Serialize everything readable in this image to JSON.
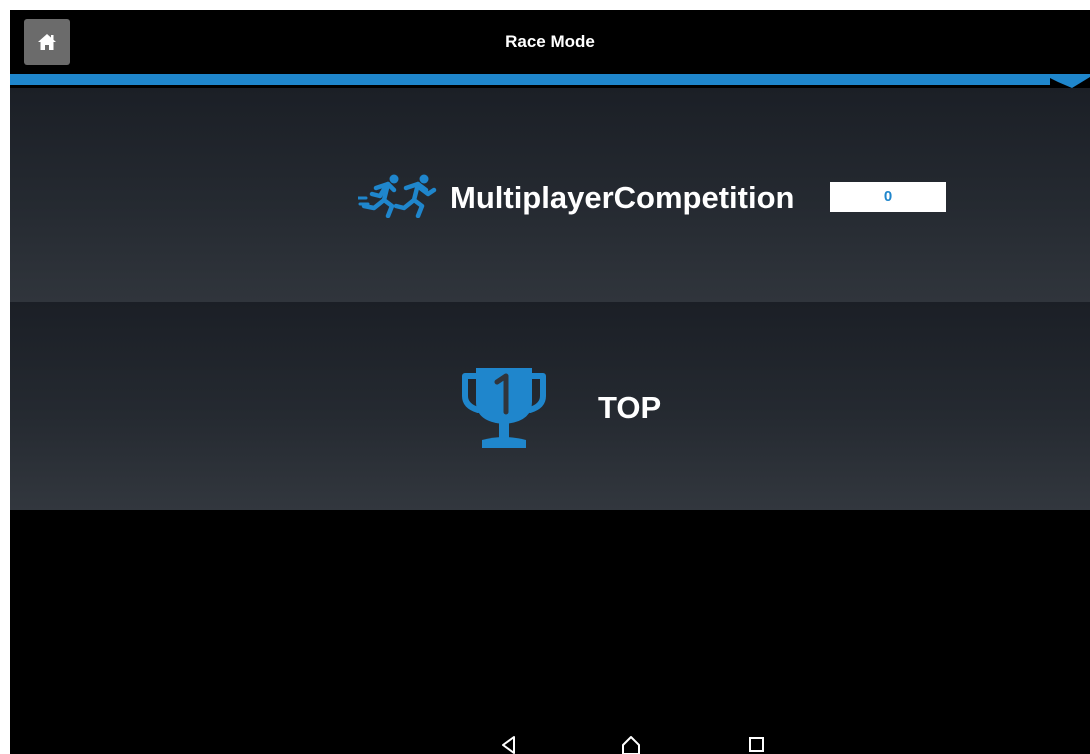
{
  "app": {
    "title": "Race Mode"
  },
  "colors": {
    "accent": "#1f86cc",
    "background": "#000000",
    "panel": "#252a31",
    "text": "#ffffff"
  },
  "toolbar": {
    "home_icon": "home-icon"
  },
  "menu": {
    "items": [
      {
        "icon": "runners-icon",
        "label": "MultiplayerCompetition",
        "badge": "0"
      },
      {
        "icon": "trophy-icon",
        "label": "TOP"
      }
    ]
  },
  "system_nav": {
    "icons": [
      "back-icon",
      "home-icon",
      "recents-icon"
    ]
  }
}
